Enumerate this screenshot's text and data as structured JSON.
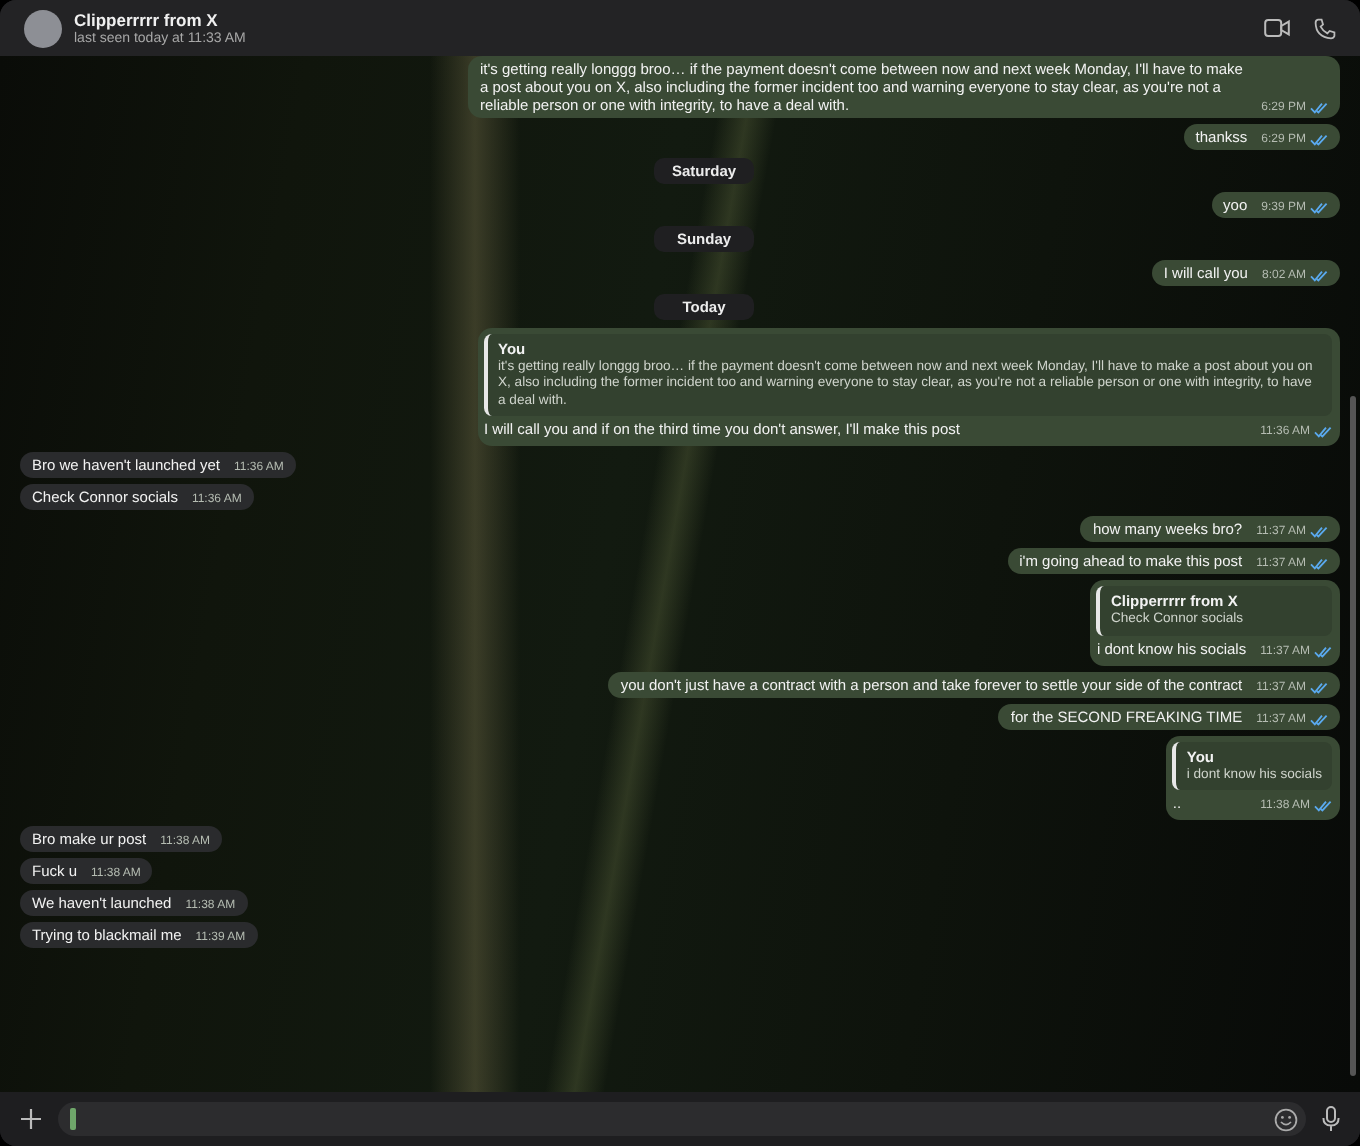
{
  "header": {
    "name": "Clipperrrrr from X",
    "status": "last seen today at 11:33 AM"
  },
  "messages": [
    {
      "kind": "out",
      "text": "it's getting really longgg broo… if the payment doesn't come between now and next week Monday, I'll have to make a post about you on X, also including the former incident too and warning everyone to stay clear, as you're not a reliable person or one with integrity, to have a deal with.",
      "time": "6:29 PM",
      "read": true
    },
    {
      "kind": "out",
      "text": "thankss",
      "time": "6:29 PM",
      "read": true
    },
    {
      "kind": "day",
      "text": "Saturday"
    },
    {
      "kind": "out",
      "text": "yoo",
      "time": "9:39 PM",
      "read": true
    },
    {
      "kind": "day",
      "text": "Sunday"
    },
    {
      "kind": "out",
      "text": "I will call you",
      "time": "8:02 AM",
      "read": true
    },
    {
      "kind": "day",
      "text": "Today"
    },
    {
      "kind": "out",
      "quote": {
        "author": "You",
        "text": "it's getting really longgg broo… if the payment doesn't come between now and next week Monday, I'll have to make a post about you on X, also including the former incident too and warning everyone to stay clear, as you're not a reliable person or one with integrity, to have a deal with."
      },
      "text": "I will call you and if on the third time you don't answer, I'll make this post",
      "time": "11:36 AM",
      "read": true
    },
    {
      "kind": "in",
      "text": "Bro we haven't launched yet",
      "time": "11:36 AM"
    },
    {
      "kind": "in",
      "text": "Check Connor socials",
      "time": "11:36 AM"
    },
    {
      "kind": "out",
      "text": "how many weeks bro?",
      "time": "11:37 AM",
      "read": true
    },
    {
      "kind": "out",
      "text": "i'm going ahead to make this post",
      "time": "11:37 AM",
      "read": true
    },
    {
      "kind": "out",
      "quote": {
        "author": "Clipperrrrr from X",
        "text": "Check Connor socials"
      },
      "text": "i dont know his socials",
      "time": "11:37 AM",
      "read": true
    },
    {
      "kind": "out",
      "text": "you don't just have a contract with a person and take forever to settle your side of the contract",
      "time": "11:37 AM",
      "read": true
    },
    {
      "kind": "out",
      "text": "for the SECOND FREAKING TIME",
      "time": "11:37 AM",
      "read": true
    },
    {
      "kind": "out",
      "quote": {
        "author": "You",
        "text": "i dont know his socials"
      },
      "text": "..",
      "time": "11:38 AM",
      "read": true
    },
    {
      "kind": "in",
      "text": "Bro make ur post",
      "time": "11:38 AM"
    },
    {
      "kind": "in",
      "text": "Fuck u",
      "time": "11:38 AM"
    },
    {
      "kind": "in",
      "text": "We haven't launched",
      "time": "11:38 AM"
    },
    {
      "kind": "in",
      "text": "Trying to blackmail me",
      "time": "11:39 AM"
    }
  ]
}
